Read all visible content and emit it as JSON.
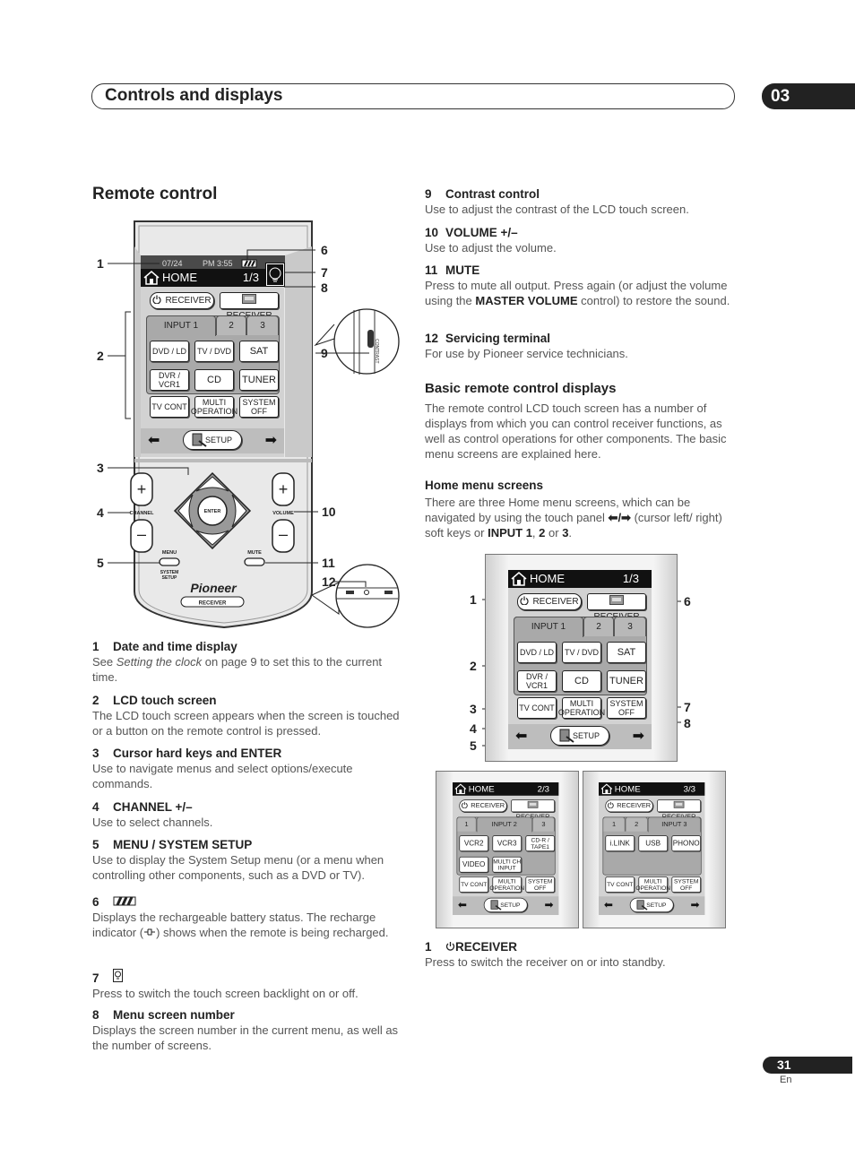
{
  "header": {
    "title": "Controls and displays",
    "chapter": "03"
  },
  "section_title": "Remote control",
  "remote": {
    "date": "07/24",
    "time": "PM 3:55",
    "channel_label": "CHANNEL",
    "volume_label": "VOLUME",
    "enter_label": "ENTER",
    "menu_label": "MENU",
    "system_setup_label": [
      "SYSTEM",
      "SETUP"
    ],
    "mute_label": "MUTE",
    "brand": "Pioneer",
    "model_label": "RECEIVER",
    "contrast_label": "CONTRAST",
    "plus": "+",
    "minus": "–",
    "callouts": [
      "1",
      "2",
      "3",
      "4",
      "5",
      "6",
      "7",
      "8",
      "9",
      "10",
      "11",
      "12"
    ]
  },
  "screens": [
    {
      "title": "HOME",
      "page": "1/3",
      "receiver_power": "RECEIVER",
      "receiver_input": "RECEIVER",
      "tabs": [
        "INPUT 1",
        "2",
        "3"
      ],
      "active_tab": 0,
      "grid": [
        [
          "DVD / LD",
          "TV / DVD",
          "SAT"
        ],
        [
          "DVR / VCR1",
          "CD",
          "TUNER"
        ]
      ],
      "bottom": [
        "TV CONT",
        "MULTI OPERATION",
        "SYSTEM OFF"
      ],
      "setup": "SETUP"
    },
    {
      "title": "HOME",
      "page": "2/3",
      "receiver_power": "RECEIVER",
      "receiver_input": "RECEIVER",
      "tabs": [
        "1",
        "INPUT 2",
        "3"
      ],
      "active_tab": 1,
      "grid": [
        [
          "VCR2",
          "VCR3",
          "CD-R / TAPE1"
        ],
        [
          "VIDEO",
          "MULTI CH INPUT"
        ]
      ],
      "bottom": [
        "TV CONT",
        "MULTI OPERATION",
        "SYSTEM OFF"
      ],
      "setup": "SETUP"
    },
    {
      "title": "HOME",
      "page": "3/3",
      "receiver_power": "RECEIVER",
      "receiver_input": "RECEIVER",
      "tabs": [
        "1",
        "2",
        "INPUT 3"
      ],
      "active_tab": 2,
      "grid": [
        [
          "i.LINK",
          "USB",
          "PHONO"
        ]
      ],
      "bottom": [
        "TV CONT",
        "MULTI OPERATION",
        "SYSTEM OFF"
      ],
      "setup": "SETUP"
    }
  ],
  "home_callouts": [
    "1",
    "2",
    "3",
    "4",
    "5",
    "6",
    "7",
    "8"
  ],
  "left_items": [
    {
      "num": "1",
      "label": "Date and time display",
      "desc": [
        "See ",
        "Setting the clock",
        " on page 9 to set this to the current time."
      ]
    },
    {
      "num": "2",
      "label": "LCD touch screen",
      "desc": [
        "The LCD touch screen appears when the screen is touched or a button on the remote control is pressed."
      ]
    },
    {
      "num": "3",
      "label": "Cursor hard keys and ENTER",
      "desc": [
        "Use to navigate menus and select options/execute commands."
      ]
    },
    {
      "num": "4",
      "label": "CHANNEL  +/–",
      "desc": [
        "Use to select channels."
      ]
    },
    {
      "num": "5",
      "label": "MENU / SYSTEM SETUP",
      "desc": [
        "Use to display the System Setup menu (or a menu when controlling other components, such as a DVD or TV)."
      ]
    },
    {
      "num": "6",
      "icon": "battery-icon",
      "desc": [
        "Displays the rechargeable battery status. The recharge indicator (",
        ") shows when the remote is being recharged."
      ],
      "inline_icon": "recharge-plug-icon"
    },
    {
      "num": "7",
      "icon": "backlight-icon",
      "desc": [
        "Press to switch the touch screen backlight on or off."
      ]
    },
    {
      "num": "8",
      "label": "Menu screen number",
      "desc": [
        "Displays the screen number in the current menu, as well as the number of screens."
      ]
    }
  ],
  "right_items": [
    {
      "num": "9",
      "label": "Contrast control",
      "desc": [
        "Use to adjust the contrast of the LCD touch screen."
      ]
    },
    {
      "num": "10",
      "label": "VOLUME +/–",
      "desc": [
        "Use to adjust the volume."
      ]
    },
    {
      "num": "11",
      "label": "MUTE",
      "desc": [
        "Press to mute all output. Press again (or adjust the volume using the ",
        "MASTER VOLUME",
        " control) to restore the sound."
      ]
    },
    {
      "num": "12",
      "label": "Servicing terminal",
      "desc": [
        "For use by Pioneer service technicians."
      ]
    }
  ],
  "basic_displays": {
    "title": "Basic remote control displays",
    "text": "The remote control LCD touch screen has a number of displays from which you can control receiver functions, as well as control operations for other components. The basic menu screens are explained here."
  },
  "home_menu": {
    "title": "Home menu screens",
    "text": [
      "There are three Home menu screens, which can be navigated by using the touch panel ",
      "⬅/➡",
      " (cursor left/ right) soft keys or ",
      "INPUT 1",
      ", ",
      "2",
      " or ",
      "3",
      "."
    ]
  },
  "receiver_item": {
    "num": "1",
    "label": "RECEIVER",
    "desc": "Press to switch the receiver on or into standby."
  },
  "footer": {
    "page": "31",
    "lang": "En"
  }
}
